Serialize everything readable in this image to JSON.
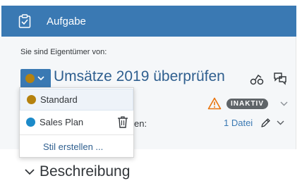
{
  "header": {
    "title": "Aufgabe",
    "icon": "clipboard-task-icon"
  },
  "task": {
    "owner_label": "Sie sind Eigentümer von:",
    "title": "Umsätze 2019 überprüfen",
    "status_badge": "INAKTIV",
    "attachments_label_fragment": "en:",
    "attachments_link": "1 Datei"
  },
  "status_menu": {
    "items": [
      {
        "label": "Standard",
        "color": "#b5820f"
      },
      {
        "label": "Sales Plan",
        "color": "#1c8ac9"
      }
    ],
    "create_label": "Stil erstellen ..."
  },
  "section": {
    "title": "Beschreibung"
  },
  "colors": {
    "brand_blue": "#3a79b3",
    "title_blue": "#2f5f8f",
    "warning": "#e9730c",
    "badge_grey": "#5f6468"
  }
}
